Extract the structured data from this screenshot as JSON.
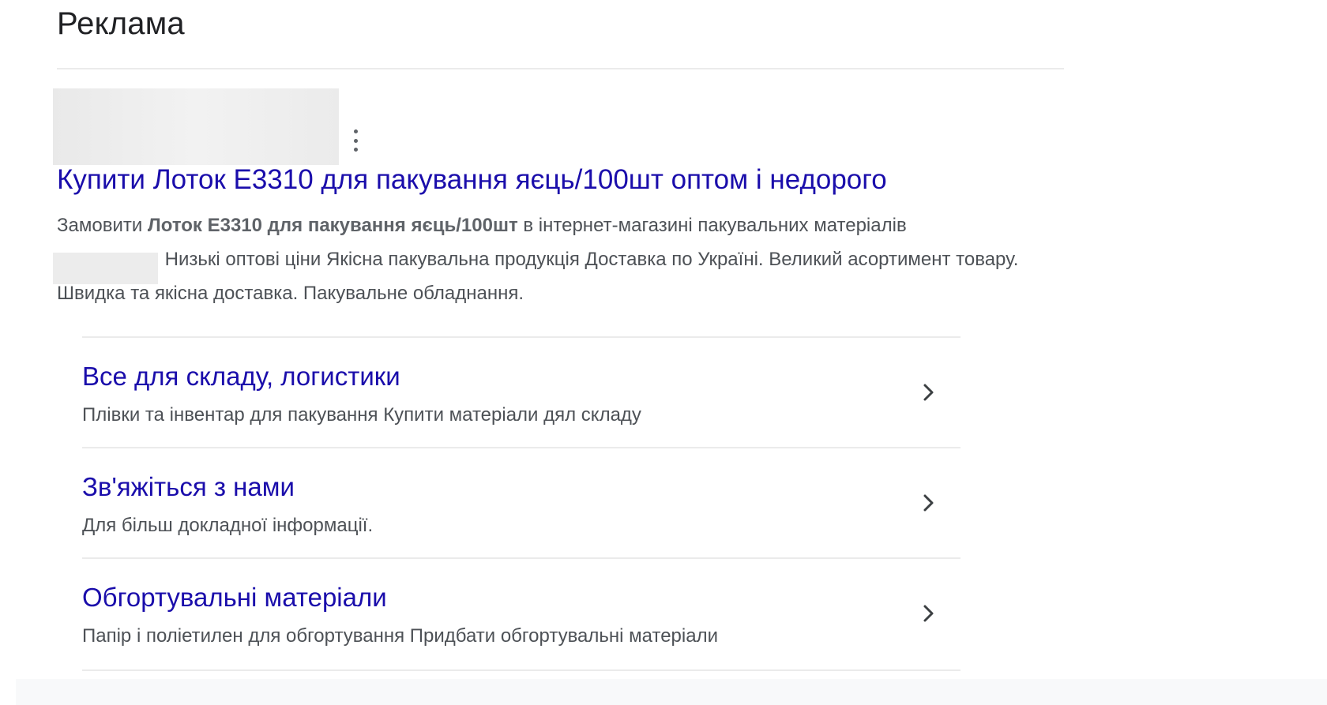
{
  "ad": {
    "header": "Реклама",
    "title": "Купити Лоток Е3310 для пакування яєць/100шт оптом і недорого",
    "description": {
      "before_bold": "Замовити ",
      "bold": "Лоток Е3310 для пакування яєць/100шт",
      "after_bold": " в інтернет-магазині пакувальних матеріалів",
      "line2": " Низькі оптові ціни Якісна пакувальна продукція Доставка по Україні. Великий асортимент товару. Швидка та якісна доставка. Пакувальне обладнання."
    }
  },
  "sitelinks": [
    {
      "title": "Все для складу, логистики",
      "description": "Плівки та інвентар для пакування Купити матеріали дял складу"
    },
    {
      "title": "Зв'яжіться з нами",
      "description": "Для більш докладної інформації."
    },
    {
      "title": "Обгортувальні матеріали",
      "description": "Папір і поліетилен для обгортування Придбати обгортувальні матеріали"
    }
  ],
  "icons": {
    "more": "more-vert-icon",
    "chevron": "chevron-right-icon"
  },
  "colors": {
    "link": "#1a0dab",
    "text": "#4d5156",
    "heading": "#202124",
    "divider": "#ebebeb"
  }
}
